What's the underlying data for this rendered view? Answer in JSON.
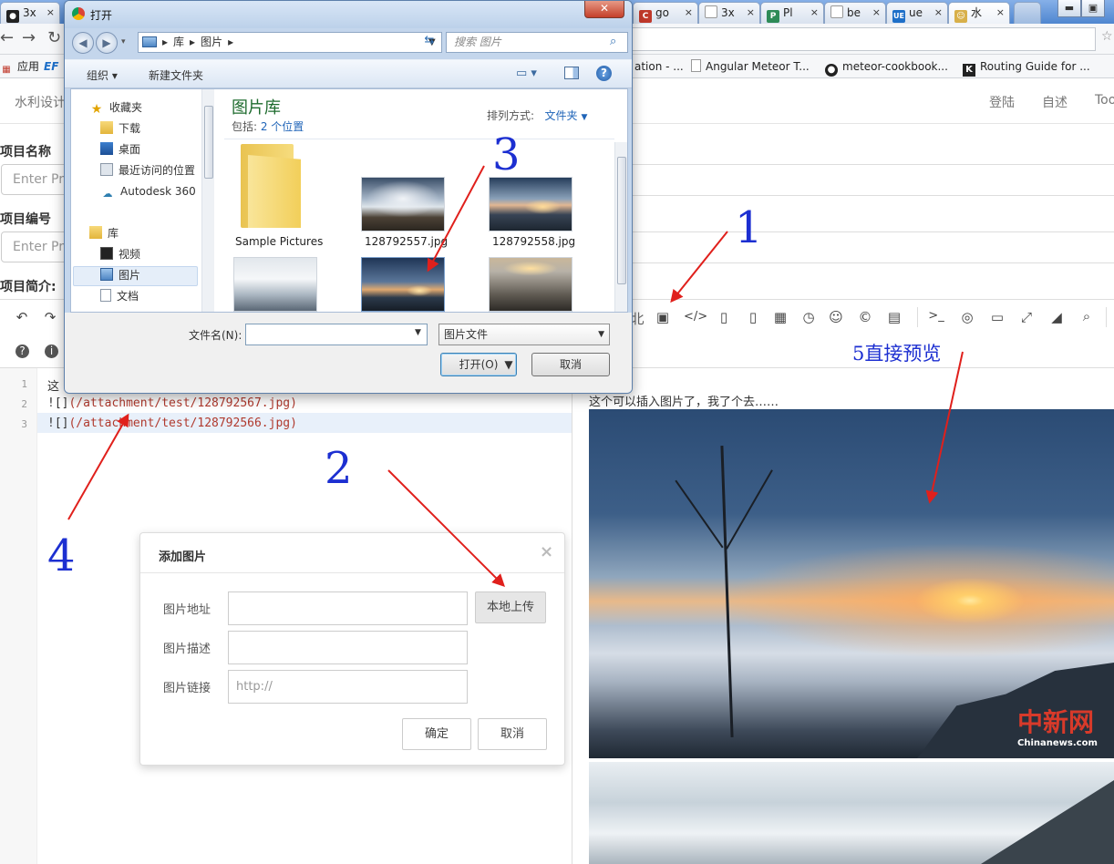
{
  "browser": {
    "tabs": [
      {
        "label": "3x",
        "fav_color": "#222222",
        "fav_glyph": "●"
      },
      {
        "label": "go",
        "fav_color": "#c0392b",
        "fav_glyph": "C"
      },
      {
        "label": "3x",
        "fav_color": "#cfd8e3",
        "fav_glyph": ""
      },
      {
        "label": "Pl",
        "fav_color": "#2e8b57",
        "fav_glyph": "P"
      },
      {
        "label": "be",
        "fav_color": "#cfd8e3",
        "fav_glyph": ""
      },
      {
        "label": "ue",
        "fav_color": "#1e6fc8",
        "fav_glyph": "UE"
      },
      {
        "label": "水",
        "fav_color": "#d8b04a",
        "fav_glyph": "☺"
      }
    ],
    "tab_close_glyph": "×",
    "win_min": "▬",
    "win_max": "▣",
    "win_close": "✕",
    "bookmarks": [
      {
        "label": "应用",
        "icon": "apps-icon"
      },
      {
        "label": "EF",
        "icon": "ef-icon"
      },
      {
        "label": "ation - ...",
        "icon": ""
      },
      {
        "label": "Angular Meteor T...",
        "icon": "page-icon"
      },
      {
        "label": "meteor-cookbook...",
        "icon": "github-icon"
      },
      {
        "label": "Routing Guide for ...",
        "icon": "k-icon"
      }
    ]
  },
  "navbar": {
    "brand": "水利设计",
    "links": [
      "登陆",
      "自述",
      "Too"
    ]
  },
  "form": {
    "name_label": "项目名称",
    "name_placeholder": "Enter Pro",
    "code_label": "项目编号",
    "code_placeholder": "Enter Pro",
    "intro_label": "项目简介:"
  },
  "editor": {
    "toolbar_left_icons": [
      "undo-icon",
      "redo-icon",
      "help-icon",
      "info-icon"
    ],
    "toolbar_right_icons": [
      "image-icon",
      "code-icon",
      "code-file-icon",
      "code-block-icon",
      "table-icon",
      "clock-icon",
      "emoji-icon",
      "copyright-icon",
      "page-break-icon",
      "terminal-icon",
      "eye-off-icon",
      "desktop-icon",
      "fullscreen-icon",
      "eraser-icon",
      "search-icon"
    ],
    "toolbar_right_partial": "北",
    "line_numbers": [
      "1",
      "2",
      "3"
    ],
    "lines": [
      {
        "prefix": "这",
        "url": ""
      },
      {
        "prefix": "![]",
        "url": "(/attachment/test/128792567.jpg)"
      },
      {
        "prefix": "![]",
        "url": "(/attachment/test/128792566.jpg)"
      }
    ]
  },
  "preview": {
    "text": "这个可以插入图片了，我了个去……",
    "watermark": "中新网",
    "watermark_en": "Chinanews.com"
  },
  "file_dialog": {
    "title": "打开",
    "close_glyph": "✕",
    "path": [
      "库",
      "图片"
    ],
    "search_placeholder": "搜索 图片",
    "organize": "组织 ▾",
    "new_folder": "新建文件夹",
    "tree": [
      {
        "label": "收藏夹",
        "icon": "star-icon"
      },
      {
        "label": "下载",
        "icon": "download-folder-icon"
      },
      {
        "label": "桌面",
        "icon": "desktop-folder-icon"
      },
      {
        "label": "最近访问的位置",
        "icon": "recent-icon"
      },
      {
        "label": "Autodesk 360",
        "icon": "cloud-icon"
      },
      {
        "label": "库",
        "icon": "library-icon"
      },
      {
        "label": "视频",
        "icon": "video-icon"
      },
      {
        "label": "图片",
        "icon": "pictures-icon"
      },
      {
        "label": "文档",
        "icon": "documents-icon"
      }
    ],
    "library_title": "图片库",
    "library_sub_prefix": "包括: ",
    "library_sub_link": "2 个位置",
    "sort_label": "排列方式:",
    "sort_value": "文件夹",
    "files": [
      {
        "name": "Sample Pictures"
      },
      {
        "name": "128792557.jpg"
      },
      {
        "name": "128792558.jpg"
      }
    ],
    "filename_label": "文件名(N):",
    "filename_value": "",
    "filetype": "图片文件",
    "open_button": "打开(O)",
    "cancel_button": "取消"
  },
  "image_modal": {
    "title": "添加图片",
    "close_glyph": "×",
    "url_label": "图片地址",
    "desc_label": "图片描述",
    "link_label": "图片链接",
    "link_placeholder": "http://",
    "upload_button": "本地上传",
    "ok_button": "确定",
    "cancel_button": "取消"
  },
  "annotations": {
    "n1": "1",
    "n2": "2",
    "n3": "3",
    "n4": "4",
    "n5": "5直接预览",
    "arrow_color": "#e0201c"
  }
}
